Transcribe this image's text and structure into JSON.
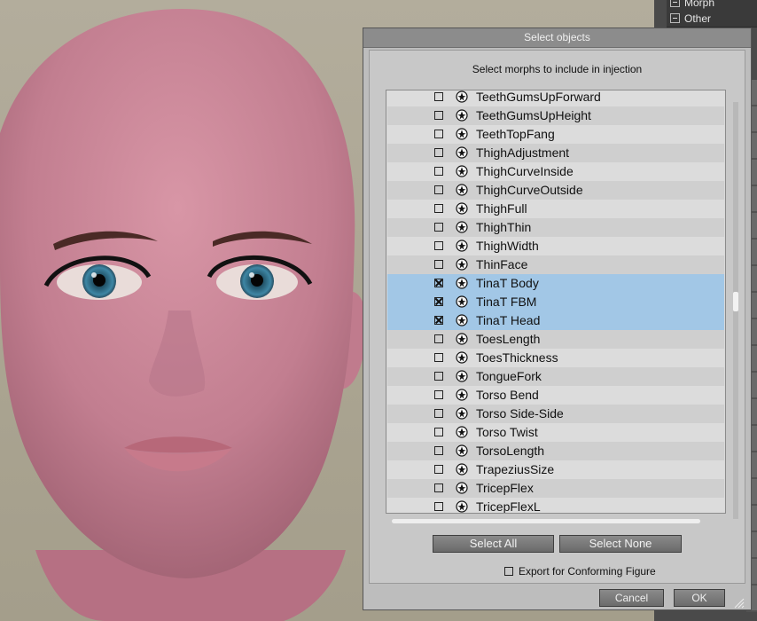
{
  "side_panel": {
    "items": [
      {
        "label": "Morph"
      },
      {
        "label": "Other"
      }
    ]
  },
  "dialog": {
    "title": "Select objects",
    "subtitle": "Select morphs to include in injection",
    "morphs": [
      {
        "label": "TeethGumsUpForward",
        "checked": false
      },
      {
        "label": "TeethGumsUpHeight",
        "checked": false
      },
      {
        "label": "TeethTopFang",
        "checked": false
      },
      {
        "label": "ThighAdjustment",
        "checked": false
      },
      {
        "label": "ThighCurveInside",
        "checked": false
      },
      {
        "label": "ThighCurveOutside",
        "checked": false
      },
      {
        "label": "ThighFull",
        "checked": false
      },
      {
        "label": "ThighThin",
        "checked": false
      },
      {
        "label": "ThighWidth",
        "checked": false
      },
      {
        "label": "ThinFace",
        "checked": false
      },
      {
        "label": "TinaT Body",
        "checked": true
      },
      {
        "label": "TinaT FBM",
        "checked": true
      },
      {
        "label": "TinaT Head",
        "checked": true
      },
      {
        "label": "ToesLength",
        "checked": false
      },
      {
        "label": "ToesThickness",
        "checked": false
      },
      {
        "label": "TongueFork",
        "checked": false
      },
      {
        "label": "Torso Bend",
        "checked": false
      },
      {
        "label": "Torso Side-Side",
        "checked": false
      },
      {
        "label": "Torso Twist",
        "checked": false
      },
      {
        "label": "TorsoLength",
        "checked": false
      },
      {
        "label": "TrapeziusSize",
        "checked": false
      },
      {
        "label": "TricepFlex",
        "checked": false
      },
      {
        "label": "TricepFlexL",
        "checked": false
      }
    ],
    "select_all_label": "Select All",
    "select_none_label": "Select None",
    "export_label": "Export for Conforming Figure",
    "export_checked": false,
    "cancel_label": "Cancel",
    "ok_label": "OK"
  },
  "colors": {
    "selection": "#a2c7e6",
    "dialog_bg": "#c8c8c8",
    "titlebar": "#8c8c8c"
  }
}
